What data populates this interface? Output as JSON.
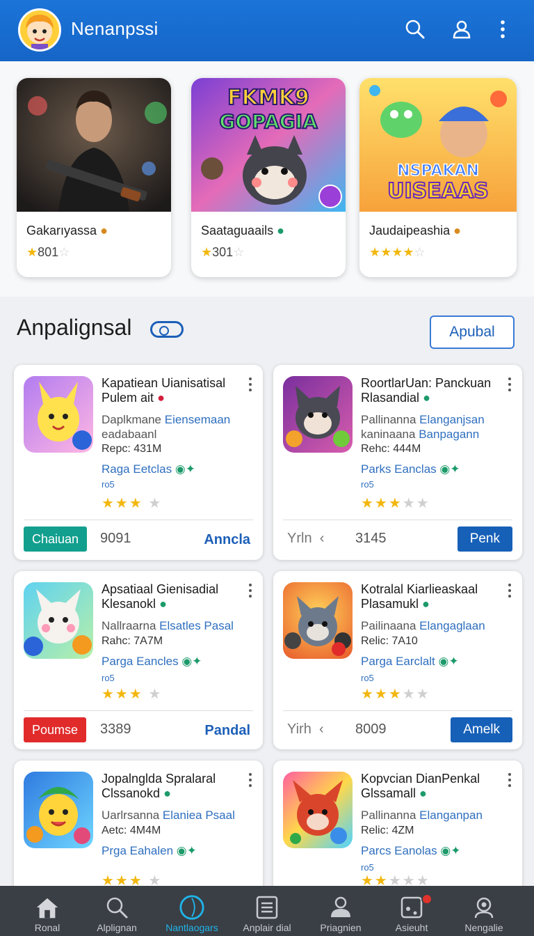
{
  "header": {
    "app_title": "Nenanpssi",
    "icons": [
      "search-icon",
      "user-icon",
      "more-vertical-icon"
    ],
    "brand_color": "#1b74d8"
  },
  "featured": [
    {
      "title": "Gakarıyassa",
      "rating_text": "801",
      "stars": 1,
      "theme": "action"
    },
    {
      "title": "Saataguaails",
      "rating_text": "301",
      "stars": 1,
      "theme": "casual",
      "thumb_text": [
        "FKMK9",
        "GOPAGIA"
      ]
    },
    {
      "title": "Jaudaipeashia",
      "rating_text": "",
      "stars": 4,
      "theme": "party",
      "thumb_text": [
        "NSPAKAN",
        "UISEAAS"
      ]
    }
  ],
  "section": {
    "title": "Anpalignsal",
    "button_label": "Apubal"
  },
  "apps": [
    {
      "title_1": "Kapatiean Uianisatisal",
      "title_2": "Pulem ait",
      "desc_plain": "Daplkmane",
      "desc_hl": "Eiensemaan",
      "desc_2": "eadabaanl",
      "size": "Repc: 431M",
      "category": "Raga Eetclas",
      "sub": "ro5",
      "stars": 3,
      "footer": {
        "badge": "Chaiuan",
        "badge_color": "#129f8e",
        "number": "9091",
        "link": "Anncla"
      }
    },
    {
      "title_1": "RoortlarUan: Panckuan",
      "title_2": "Rlasandial",
      "desc_plain": "Pallinanna",
      "desc_hl": "Elanganjsan",
      "desc_2": "kaninaana",
      "desc_2_hl": "Banpagann",
      "size": "Rehc: 444M",
      "category": "Parks Eanclas",
      "sub": "ro5",
      "stars": 3,
      "footer": {
        "left_text": "Yrln",
        "number": "3145",
        "button": "Penk"
      }
    },
    {
      "title_1": "Apsatiaal Gienisadial",
      "title_2": "Klesanokl",
      "desc_plain": "Nallraarna",
      "desc_hl": "Elsatles Pasal",
      "size": "Rahc: 7A7M",
      "category": "Parga Eancles",
      "sub": "ro5",
      "stars": 3,
      "footer": {
        "badge": "Poumse",
        "badge_color": "#e12b2b",
        "number": "3389",
        "link": "Pandal"
      }
    },
    {
      "title_1": "Kotralal Kiarlieaskaal",
      "title_2": "Plasamukl",
      "desc_plain": "Pailinaana",
      "desc_hl": "Elangaglaan",
      "size": "Relic: 7A10",
      "category": "Parga Earclalt",
      "sub": "ro5",
      "stars": 3,
      "footer": {
        "left_text": "Yirh",
        "number": "8009",
        "button": "Amelk"
      }
    },
    {
      "title_1": "Jopalnglda Spralaral",
      "title_2": "Clssanokd",
      "desc_plain": "Uarlrsanna",
      "desc_hl": "Elaniea Psaal",
      "size": "Aetc: 4M4M",
      "category": "Prga Eahalen",
      "sub": "",
      "stars": 3,
      "footer": null
    },
    {
      "title_1": "Kopvcian DianPenkal",
      "title_2": "Glssamall",
      "desc_plain": "Pallinanna",
      "desc_hl": "Elanganpan",
      "size": "Relic: 4ZM",
      "category": "Parcs Eanolas",
      "sub": "ro5",
      "stars": 2,
      "footer": null
    }
  ],
  "bottom_nav": [
    {
      "label": "Ronal",
      "icon": "home-icon"
    },
    {
      "label": "Alplignan",
      "icon": "search-icon"
    },
    {
      "label": "Nantlaogars",
      "icon": "discover-icon",
      "active": true
    },
    {
      "label": "Anplair dial",
      "icon": "list-icon"
    },
    {
      "label": "Priagnien",
      "icon": "profile-icon"
    },
    {
      "label": "Asieuht",
      "icon": "notification-icon",
      "badge": true
    },
    {
      "label": "Nengalie",
      "icon": "settings-icon"
    }
  ]
}
